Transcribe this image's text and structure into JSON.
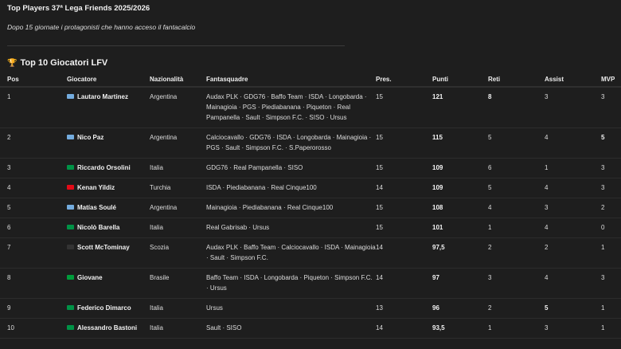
{
  "title": "Top Players 37ª Lega Friends 2025/2026",
  "subtitle": "Dopo 15 giornate i protagonisti che hanno acceso il fantacalcio",
  "section": {
    "icon": "trophy-icon",
    "glyph": "🏆",
    "heading": "Top 10 Giocatori LFV"
  },
  "columns": [
    "Pos",
    "Giocatore",
    "Nazionalità",
    "Fantasquadre",
    "Pres.",
    "Punti",
    "Reti",
    "Assist",
    "MVP"
  ],
  "flag_colors": {
    "Argentina": "#74acdf",
    "Italia": "#009246",
    "Turchia": "#e30a17",
    "Scozia": "#333333",
    "Brasile": "#009c3b"
  },
  "rows": [
    {
      "pos": "1",
      "player": "Lautaro Martinez",
      "nation": "Argentina",
      "teams": "Audax PLK · GDG76 · Baffo Team · ISDA · Longobarda · Mainagioia · PGS · Piediabanana · Piqueton · Real Pampanella · Sault · Simpson F.C. · SISO · Ursus",
      "pres": "15",
      "punti": "121",
      "reti": "8",
      "assist": "3",
      "mvp": "3",
      "bold": [
        "reti"
      ]
    },
    {
      "pos": "2",
      "player": "Nico Paz",
      "nation": "Argentina",
      "teams": "Calciocavallo · GDG76 · ISDA · Longobarda · Mainagioia · PGS · Sault · Simpson F.C. · S.Paperorosso",
      "pres": "15",
      "punti": "115",
      "reti": "5",
      "assist": "4",
      "mvp": "5",
      "bold": [
        "mvp"
      ]
    },
    {
      "pos": "3",
      "player": "Riccardo Orsolini",
      "nation": "Italia",
      "teams": "GDG76 · Real Pampanella · SISO",
      "pres": "15",
      "punti": "109",
      "reti": "6",
      "assist": "1",
      "mvp": "3",
      "bold": []
    },
    {
      "pos": "4",
      "player": "Kenan Yildiz",
      "nation": "Turchia",
      "teams": "ISDA · Piediabanana · Real Cinque100",
      "pres": "14",
      "punti": "109",
      "reti": "5",
      "assist": "4",
      "mvp": "3",
      "bold": []
    },
    {
      "pos": "5",
      "player": "Matías Soulé",
      "nation": "Argentina",
      "teams": "Mainagioia · Piediabanana · Real Cinque100",
      "pres": "15",
      "punti": "108",
      "reti": "4",
      "assist": "3",
      "mvp": "2",
      "bold": []
    },
    {
      "pos": "6",
      "player": "Nicolò Barella",
      "nation": "Italia",
      "teams": "Real Gabrisab · Ursus",
      "pres": "15",
      "punti": "101",
      "reti": "1",
      "assist": "4",
      "mvp": "0",
      "bold": []
    },
    {
      "pos": "7",
      "player": "Scott McTominay",
      "nation": "Scozia",
      "teams": "Audax PLK · Baffo Team · Calciocavallo · ISDA · Mainagioia · Sault · Simpson F.C.",
      "pres": "14",
      "punti": "97,5",
      "reti": "2",
      "assist": "2",
      "mvp": "1",
      "bold": []
    },
    {
      "pos": "8",
      "player": "Giovane",
      "nation": "Brasile",
      "teams": "Baffo Team · ISDA · Longobarda · Piqueton · Simpson F.C. · Ursus",
      "pres": "14",
      "punti": "97",
      "reti": "3",
      "assist": "4",
      "mvp": "3",
      "bold": []
    },
    {
      "pos": "9",
      "player": "Federico Dimarco",
      "nation": "Italia",
      "teams": "Ursus",
      "pres": "13",
      "punti": "96",
      "reti": "2",
      "assist": "5",
      "mvp": "1",
      "bold": [
        "assist"
      ]
    },
    {
      "pos": "10",
      "player": "Alessandro Bastoni",
      "nation": "Italia",
      "teams": "Sault · SISO",
      "pres": "14",
      "punti": "93,5",
      "reti": "1",
      "assist": "3",
      "mvp": "1",
      "bold": []
    }
  ]
}
